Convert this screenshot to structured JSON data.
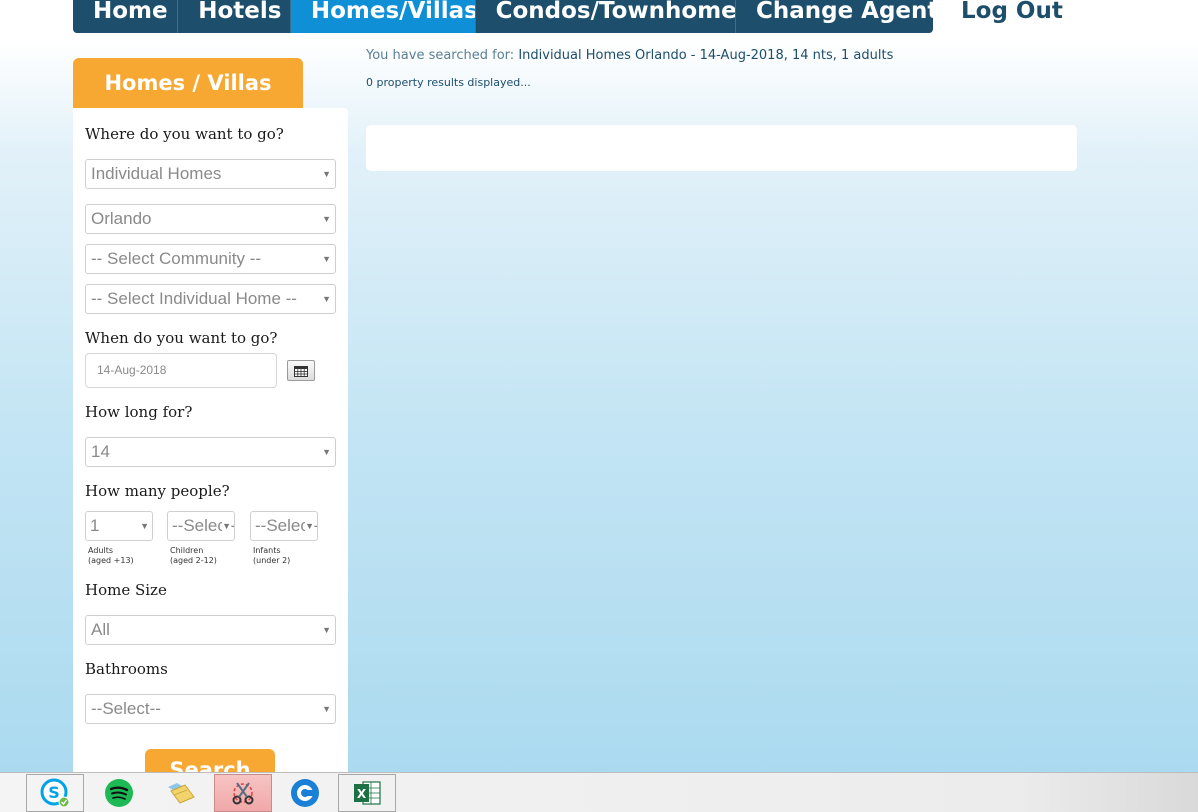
{
  "nav": {
    "items": [
      {
        "label": "Home",
        "active": false
      },
      {
        "label": "Hotels",
        "active": false
      },
      {
        "label": "Homes/Villas",
        "active": true
      },
      {
        "label": "Condos/Townhomes",
        "active": false
      },
      {
        "label": "Change Agent",
        "active": false
      }
    ],
    "logout": "Log Out"
  },
  "sidebar": {
    "tab_title": "Homes / Villas",
    "where_label": "Where do you want to go?",
    "type_select": "Individual Homes",
    "city_select": "Orlando",
    "community_select": "-- Select Community --",
    "home_select": "-- Select Individual Home --",
    "when_label": "When do you want to go?",
    "date_value": "14-Aug-2018",
    "how_long_label": "How long for?",
    "nights_select": "14",
    "people_label": "How many people?",
    "adults_select": "1",
    "children_select": "--Select--",
    "infants_select": "--Select--",
    "adults_label": "Adults",
    "adults_sub": "(aged +13)",
    "children_label": "Children",
    "children_sub": "(aged 2-12)",
    "infants_label": "Infants",
    "infants_sub": "(under 2)",
    "home_size_label": "Home Size",
    "home_size_select": "All",
    "bathrooms_label": "Bathrooms",
    "bathrooms_select": "--Select--",
    "search_button": "Search"
  },
  "main": {
    "search_prefix": "You have searched for:",
    "search_terms": "Individual Homes Orlando - 14-Aug-2018, 14 nts, 1 adults",
    "results_count": "0 property results displayed..."
  },
  "taskbar": {
    "items": [
      "outlook-icon",
      "skype-icon",
      "spotify-icon",
      "file-explorer-icon",
      "snipping-tool-icon",
      "browser-icon",
      "excel-icon"
    ]
  },
  "colors": {
    "nav_bg": "#1d4e6b",
    "nav_active": "#0f8fd6",
    "accent_orange": "#f7a832",
    "text_dark_blue": "#1d4e6b"
  }
}
